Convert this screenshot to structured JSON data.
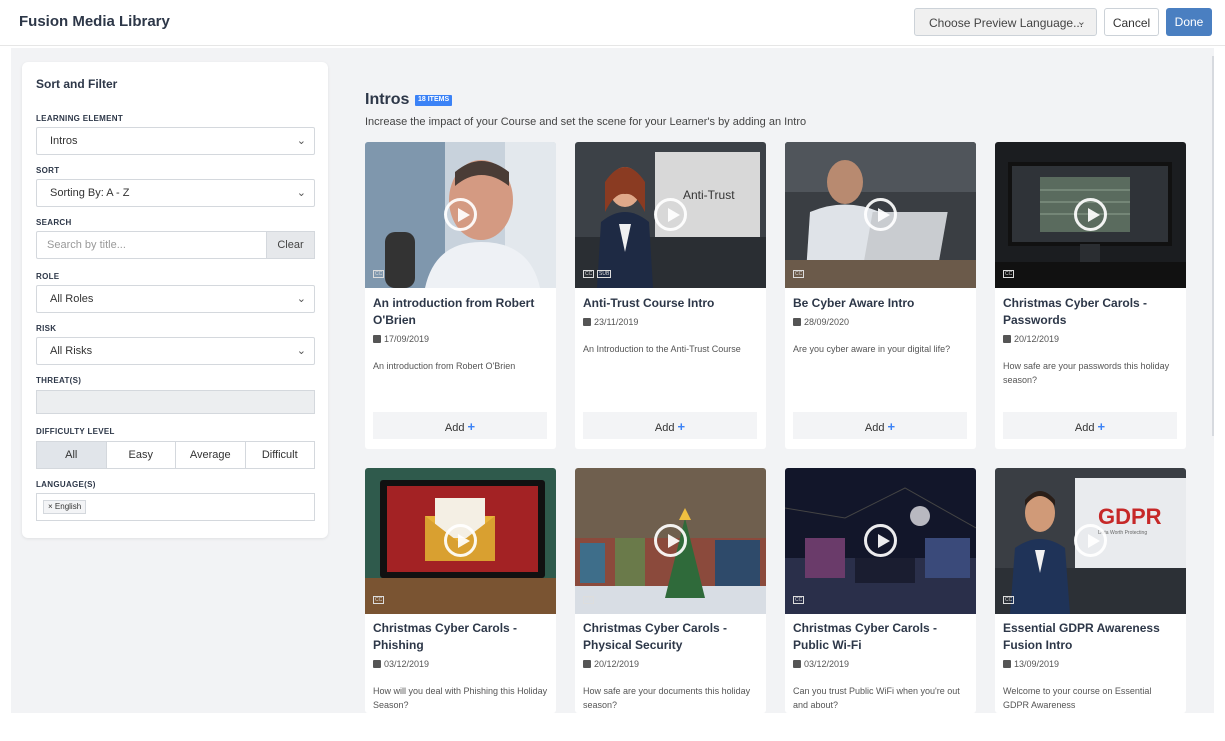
{
  "app": {
    "title": "Fusion Media Library"
  },
  "header": {
    "language_select": "Choose Preview Language...",
    "cancel_label": "Cancel",
    "done_label": "Done"
  },
  "sidebar": {
    "title": "Sort and Filter",
    "learning_element": {
      "label": "LEARNING ELEMENT",
      "value": "Intros"
    },
    "sort": {
      "label": "SORT",
      "value": "Sorting By: A - Z"
    },
    "search": {
      "label": "SEARCH",
      "placeholder": "Search by title...",
      "clear_label": "Clear"
    },
    "role": {
      "label": "ROLE",
      "value": "All Roles"
    },
    "risk": {
      "label": "RISK",
      "value": "All Risks"
    },
    "threats": {
      "label": "THREAT(S)"
    },
    "difficulty": {
      "label": "DIFFICULTY LEVEL",
      "options": [
        "All",
        "Easy",
        "Average",
        "Difficult"
      ],
      "selected": "All"
    },
    "languages": {
      "label": "LANGUAGE(S)",
      "tags": [
        "English"
      ]
    }
  },
  "section": {
    "title": "Intros",
    "badge": "18 ITEMS",
    "description": "Increase the impact of your Course and set the scene for your Learner's by adding an Intro"
  },
  "cards": [
    {
      "title": "An introduction from Robert O'Brien",
      "date": "17/09/2019",
      "description": "An introduction from Robert O'Brien",
      "add_label": "Add",
      "captions": [
        "CC"
      ]
    },
    {
      "title": "Anti-Trust Course Intro",
      "date": "23/11/2019",
      "description": "An Introduction to the Anti-Trust Course",
      "add_label": "Add",
      "captions": [
        "CC",
        "SUB"
      ],
      "thumb_text": "Anti-Trust"
    },
    {
      "title": "Be Cyber Aware Intro",
      "date": "28/09/2020",
      "description": "Are you cyber aware in your digital life?",
      "add_label": "Add",
      "captions": [
        "CC"
      ]
    },
    {
      "title": "Christmas Cyber Carols - Passwords",
      "date": "20/12/2019",
      "description": "How safe are your passwords this holiday season?",
      "add_label": "Add",
      "captions": [
        "CC"
      ]
    },
    {
      "title": "Christmas Cyber Carols - Phishing",
      "date": "03/12/2019",
      "description": "How will you deal with Phishing this Holiday Season?",
      "captions": [
        "CC"
      ]
    },
    {
      "title": "Christmas Cyber Carols - Physical Security",
      "date": "20/12/2019",
      "description": "How safe are your documents this holiday season?",
      "captions": [
        "CC"
      ]
    },
    {
      "title": "Christmas Cyber Carols - Public Wi-Fi",
      "date": "03/12/2019",
      "description": "Can you trust Public WiFi when you're out and about?",
      "captions": [
        "CC"
      ]
    },
    {
      "title": "Essential GDPR Awareness Fusion Intro",
      "date": "13/09/2019",
      "description": "Welcome to your course on Essential GDPR Awareness",
      "captions": [
        "CC"
      ],
      "thumb_text": "GDPR",
      "thumb_subtext": "Data Worth Protecting"
    }
  ],
  "colors": {
    "accent": "#3b82f6",
    "done_button": "#4a7fc1",
    "background": "#f2f3f5"
  }
}
